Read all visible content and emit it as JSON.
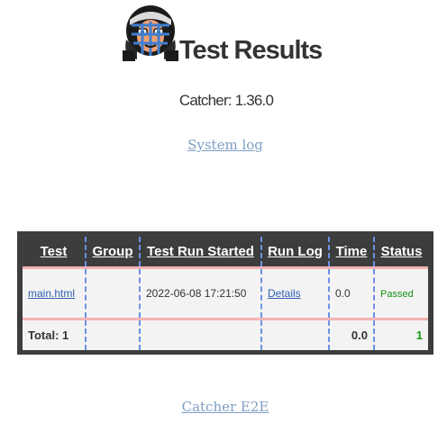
{
  "header": {
    "title": "Test Results",
    "logo_icon": "catcher-mask-logo"
  },
  "version_text": "Catcher: 1.36.0",
  "links": {
    "system_log": "System log",
    "footer": "Catcher E2E"
  },
  "results_table": {
    "columns": [
      "Test",
      "Group",
      "Test Run Started",
      "Run Log",
      "Time",
      "Status"
    ],
    "rows": [
      {
        "test": "main.html",
        "group": "",
        "started": "2022-06-08 17:21:50",
        "run_log": "Details",
        "time": "0.0",
        "status": "Passed"
      }
    ],
    "total": {
      "label": "Total: 1",
      "time": "0.0",
      "passed": "1"
    }
  },
  "colors": {
    "table_frame": "#3d3d3d",
    "column_divider": "#6d8fe6",
    "row_divider": "#f2b3b3",
    "status_passed": "#149414",
    "link": "#7f9fc2"
  }
}
